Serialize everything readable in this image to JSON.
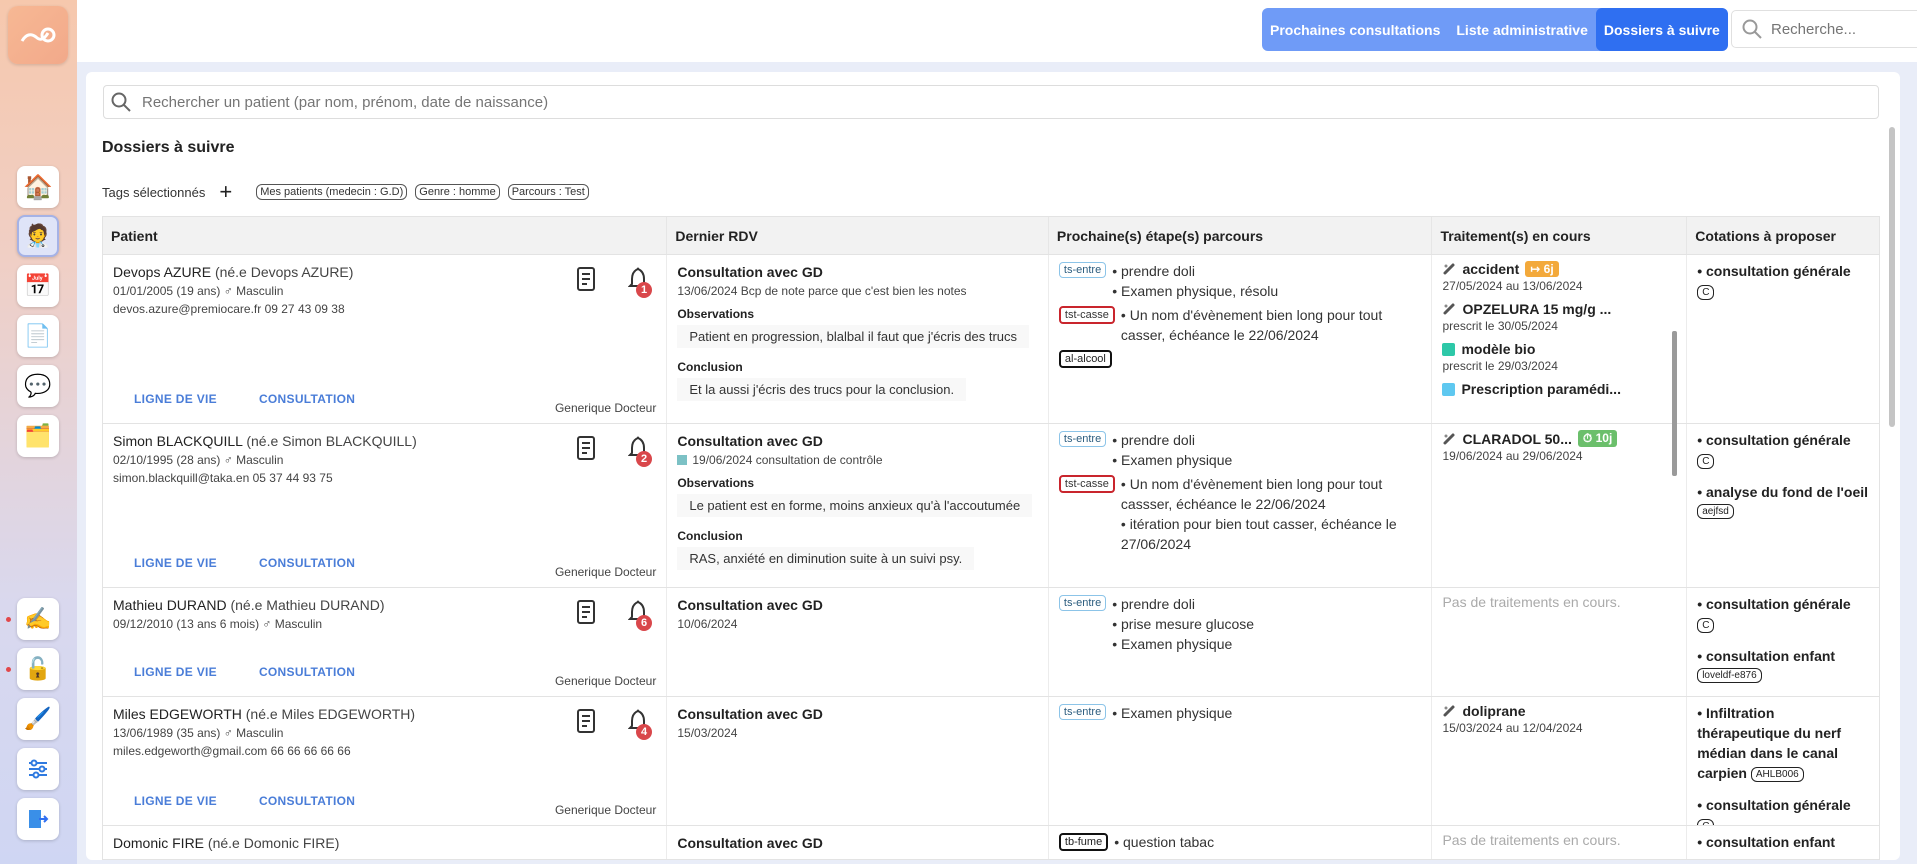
{
  "topbar": {
    "tabs": [
      "Prochaines consultations",
      "Liste administrative",
      "Dossiers à suivre"
    ],
    "active_tab": "Dossiers à suivre",
    "search_placeholder": "Recherche..."
  },
  "main": {
    "patient_search_placeholder": "Rechercher un patient (par nom, prénom, date de naissance)",
    "title": "Dossiers à suivre",
    "tags_label": "Tags sélectionnés",
    "tags": [
      "Mes patients (medecin : G.D)",
      "Genre : homme",
      "Parcours : Test"
    ],
    "columns": [
      "Patient",
      "Dernier RDV",
      "Prochaine(s) étape(s) parcours",
      "Traitement(s) en cours",
      "Cotations à proposer"
    ],
    "link_labels": {
      "life": "LIGNE DE VIE",
      "consult": "CONSULTATION"
    },
    "labels": {
      "observations": "Observations",
      "conclusion": "Conclusion"
    },
    "rows": [
      {
        "name": "Devops AZURE",
        "born": "(né.e Devops AZURE)",
        "info": "01/01/2005 (19 ans) ♂ Masculin",
        "contact": "devos.azure@premiocare.fr 09 27 43 09 38",
        "alerts": "1",
        "doctor": "Generique Docteur",
        "rdv_title": "Consultation avec GD",
        "rdv_sub": "13/06/2024 Bcp de note parce que c'est bien les notes",
        "observations": "Patient en progression, blalbal il faut que j'écris des trucs",
        "conclusion": "Et la aussi j'écris des trucs pour la conclusion.",
        "steps": [
          {
            "tag": "ts-entre",
            "color": "blue",
            "lines": [
              "• prendre doli",
              "• Examen physique, résolu"
            ]
          },
          {
            "tag": "tst-casse",
            "color": "red",
            "lines": [
              "• Un nom d'évènement bien long pour tout casser, échéance le 22/06/2024"
            ]
          },
          {
            "tag": "al-alcool",
            "color": "black",
            "lines": []
          }
        ],
        "treatments": [
          {
            "name": "accident",
            "dates": "27/05/2024 au 13/06/2024",
            "badge": "↦ 6j",
            "badge_type": "orange",
            "icon": "pill"
          },
          {
            "name": "OPZELURA 15 mg/g ...",
            "dates": "prescrit le 30/05/2024",
            "icon": "pill"
          },
          {
            "name": "modèle bio",
            "dates": "prescrit le 29/03/2024",
            "icon": "bio",
            "icon_color": "#2dc8a8"
          },
          {
            "name": "Prescription paramédi...",
            "dates": "",
            "icon": "para",
            "icon_color": "#5ec8f0"
          }
        ],
        "cotations": [
          {
            "text": "• consultation générale",
            "code": "C"
          }
        ]
      },
      {
        "name": "Simon BLACKQUILL",
        "born": "(né.e Simon BLACKQUILL)",
        "info": "02/10/1995 (28 ans) ♂ Masculin",
        "contact": "simon.blackquill@taka.en 05 37 44 93 75",
        "alerts": "2",
        "doctor": "Generique Docteur",
        "rdv_title": "Consultation avec GD",
        "rdv_sub": "19/06/2024 consultation de contrôle",
        "rdv_square": true,
        "observations": "Le patient est en forme, moins anxieux qu'à l'accoutumée",
        "conclusion": "RAS, anxiété en diminution suite à un suivi psy.",
        "steps": [
          {
            "tag": "ts-entre",
            "color": "blue",
            "lines": [
              "• prendre doli",
              "• Examen physique"
            ]
          },
          {
            "tag": "tst-casse",
            "color": "red",
            "lines": [
              "• Un nom d'évènement bien long pour tout cassser, échéance le 22/06/2024",
              "• itération pour bien tout casser, échéance le 27/06/2024"
            ]
          }
        ],
        "treatments": [
          {
            "name": "CLARADOL 50...",
            "dates": "19/06/2024 au 29/06/2024",
            "badge": "⏱ 10j",
            "badge_type": "green",
            "icon": "pill"
          }
        ],
        "cotations": [
          {
            "text": "• consultation générale",
            "code": "C"
          },
          {
            "text": "• analyse du fond de l'oeil",
            "tag": "aejfsd"
          }
        ]
      },
      {
        "name": "Mathieu DURAND",
        "born": "(né.e Mathieu DURAND)",
        "info": "09/12/2010 (13 ans 6 mois) ♂ Masculin",
        "contact": "",
        "alerts": "6",
        "doctor": "Generique Docteur",
        "rdv_title": "Consultation avec GD",
        "rdv_sub": "10/06/2024",
        "steps": [
          {
            "tag": "ts-entre",
            "color": "blue",
            "lines": [
              "• prendre doli",
              "• prise mesure glucose",
              "• Examen physique"
            ]
          }
        ],
        "treatments_empty": "Pas de traitements en cours.",
        "cotations": [
          {
            "text": "• consultation générale",
            "code": "C"
          },
          {
            "text": "• consultation enfant",
            "tag": "loveldf-e876"
          }
        ]
      },
      {
        "name": "Miles EDGEWORTH",
        "born": "(né.e Miles EDGEWORTH)",
        "info": "13/06/1989 (35 ans) ♂ Masculin",
        "contact": "miles.edgeworth@gmail.com 66 66 66 66 66",
        "alerts": "4",
        "doctor": "Generique Docteur",
        "rdv_title": "Consultation avec GD",
        "rdv_sub": "15/03/2024",
        "steps": [
          {
            "tag": "ts-entre",
            "color": "blue",
            "lines": [
              "• Examen physique"
            ]
          }
        ],
        "treatments": [
          {
            "name": "doliprane",
            "dates": "15/03/2024 au 12/04/2024",
            "icon": "pill"
          }
        ],
        "cotations": [
          {
            "text": "• Infiltration thérapeutique du nerf médian dans le canal carpien",
            "code": "AHLB006"
          },
          {
            "text": "• consultation générale",
            "code": "C"
          }
        ]
      },
      {
        "name": "Domonic FIRE",
        "born": "(né.e Domonic FIRE)",
        "info": "",
        "contact": "",
        "alerts": "",
        "doctor": "",
        "rdv_title": "Consultation avec GD",
        "rdv_sub": "",
        "steps": [
          {
            "tag": "tb-fume",
            "color": "black",
            "lines": [
              "• question tabac"
            ]
          }
        ],
        "treatments_empty": "Pas de traitements en cours.",
        "cotations": [
          {
            "text": "• consultation enfant"
          }
        ]
      }
    ]
  }
}
